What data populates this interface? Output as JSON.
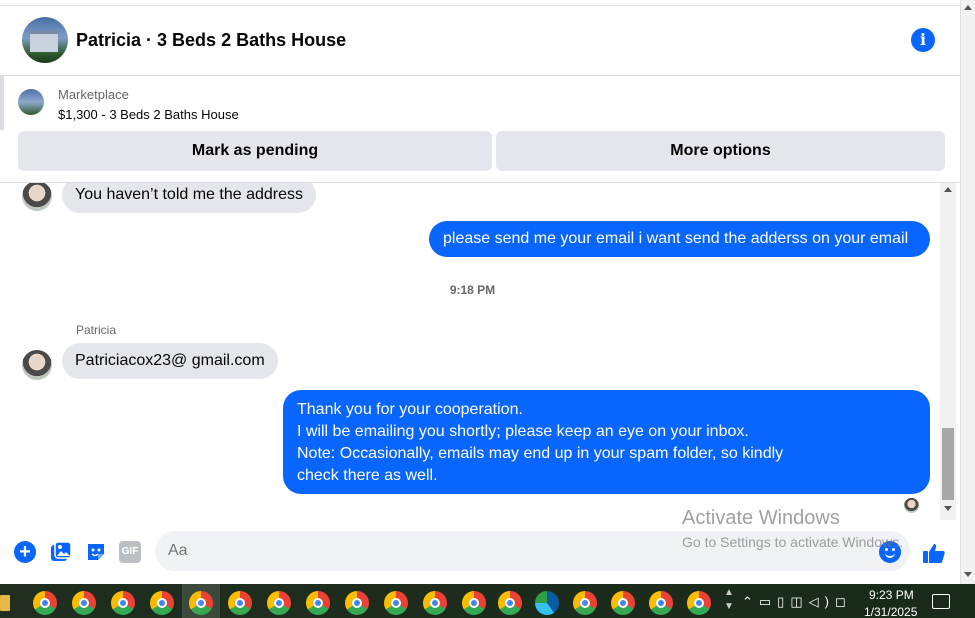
{
  "header": {
    "title": "Patricia · 3 Beds 2 Baths House"
  },
  "marketplace": {
    "label": "Marketplace",
    "listing": "$1,300 - 3 Beds 2 Baths House",
    "buttons": {
      "pending": "Mark as pending",
      "more": "More options"
    }
  },
  "messages": [
    {
      "direction": "in",
      "text": "You haven’t told me the address"
    },
    {
      "direction": "out",
      "text": "please send me your email i want send the adderss on your email"
    },
    {
      "direction": "timestamp",
      "text": "9:18 PM"
    },
    {
      "direction": "sender",
      "text": "Patricia"
    },
    {
      "direction": "in",
      "text": "Patriciacox23@ gmail.com"
    },
    {
      "direction": "out",
      "lines": [
        "Thank you for your cooperation.",
        "I will be emailing you shortly; please keep an eye on your inbox.",
        "Note: Occasionally, emails may end up in your spam folder, so kindly",
        "check there as well."
      ]
    }
  ],
  "composer": {
    "placeholder": "Aa",
    "gif_label": "GIF"
  },
  "watermark": {
    "line1": "Activate Windows",
    "line2": "Go to Settings to activate Windows."
  },
  "taskbar": {
    "time": "9:23 PM",
    "date": "1/31/2025"
  },
  "colors": {
    "accent": "#0866ff",
    "incoming_bubble": "#e4e6eb",
    "button_bg": "#e4e6eb"
  }
}
